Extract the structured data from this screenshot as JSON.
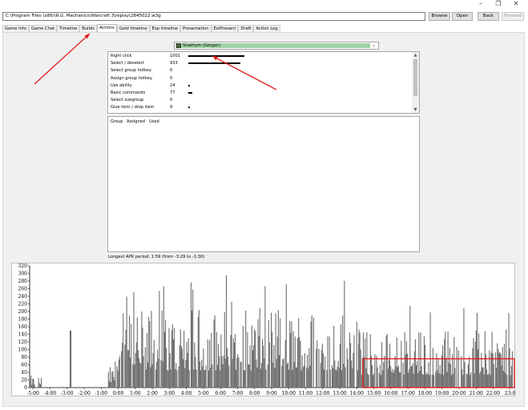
{
  "window": {
    "minimize_glyph": "–",
    "restore_glyph": "❐",
    "close_glyph": "✕"
  },
  "toolbar": {
    "path_value": "C:\\Program Files (x86)\\R.G. Mechanics\\Warcraft 3\\replay\\2845022.w3g",
    "browse_label": "Browse",
    "open_label": "Open",
    "back_label": "Back",
    "forward_label": "Forward"
  },
  "tabs": [
    {
      "label": "Game Info",
      "active": false
    },
    {
      "label": "Game Chat",
      "active": false
    },
    {
      "label": "Timeline",
      "active": false
    },
    {
      "label": "Builds",
      "active": false
    },
    {
      "label": "Actions",
      "active": true
    },
    {
      "label": "Gold timeline",
      "active": false
    },
    {
      "label": "Exp timeline",
      "active": false
    },
    {
      "label": "Presentation",
      "active": false
    },
    {
      "label": "ExtPresent",
      "active": false
    },
    {
      "label": "Draft",
      "active": false
    },
    {
      "label": "Action Log",
      "active": false
    }
  ],
  "player_select": {
    "value": "Shakhym (Gergan)",
    "icon": "player-hero-icon",
    "accent": "#9fd3a6"
  },
  "actions": [
    {
      "name": "Right click",
      "count": 1001
    },
    {
      "name": "Select / deselect",
      "count": 933
    },
    {
      "name": "Select group hotkey",
      "count": 0
    },
    {
      "name": "Assign group hotkey",
      "count": 0
    },
    {
      "name": "Use ability",
      "count": 24
    },
    {
      "name": "Basic commands",
      "count": 77
    },
    {
      "name": "Select subgroup",
      "count": 0
    },
    {
      "name": "Give item / drop item",
      "count": 9
    }
  ],
  "group_table": {
    "headers": [
      "Group",
      "Assigned",
      "Used"
    ]
  },
  "apk_info": "Longest APK period: 1:59 (from -3:29 to -1:30)",
  "chart_data": {
    "type": "bar",
    "title": "",
    "xlabel": "",
    "ylabel": "",
    "ylim": [
      0,
      320
    ],
    "y_ticks": [
      0,
      20,
      40,
      60,
      80,
      100,
      120,
      140,
      160,
      180,
      200,
      220,
      240,
      260,
      280,
      300,
      320
    ],
    "x_ticks": [
      "-5:00",
      "-4:00",
      "-3:00",
      "-2:00",
      "-1:00",
      "0:00",
      "1:00",
      "2:00",
      "3:00",
      "4:00",
      "5:00",
      "6:00",
      "7:00",
      "8:00",
      "9:00",
      "10:00",
      "11:00",
      "12:00",
      "13:00",
      "14:00",
      "15:00",
      "16:00",
      "17:00",
      "18:00",
      "19:00",
      "20:00",
      "21:00",
      "22:00",
      "23:0"
    ],
    "x_range_minutes": [
      -5.2,
      23.2
    ],
    "bar_color": "#6e6e6e",
    "segments": [
      {
        "from": -5.2,
        "to": -4.9,
        "peak": 45
      },
      {
        "from": -4.7,
        "to": -4.5,
        "peak": 45
      },
      {
        "from": -2.85,
        "to": -2.75,
        "peak": 150
      },
      {
        "from": -0.6,
        "to": -0.2,
        "peak": 80
      },
      {
        "from": -0.2,
        "to": 14.1,
        "peak": 300
      },
      {
        "from": 14.1,
        "to": 23.1,
        "peak": 220
      }
    ]
  },
  "annotations": {
    "arrow_color": "#e02020",
    "highlight_color": "#e02020"
  }
}
